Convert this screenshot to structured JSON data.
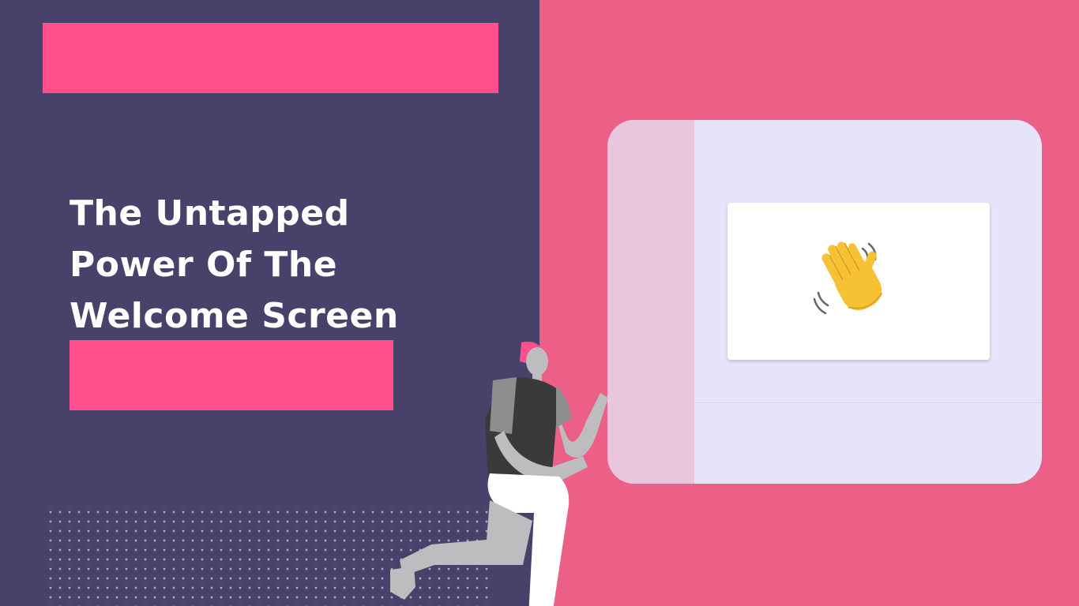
{
  "headline": {
    "lines": [
      "The Untapped",
      "Power Of The",
      "Welcome Screen"
    ]
  },
  "colors": {
    "left_background": "#48416a",
    "right_background": "#ec5f86",
    "accent_bar": "#ff4f8c",
    "mock_window": "#e5e4fa",
    "mock_sidebar": "#e8c6de"
  },
  "icons": {
    "welcome_card": "waving-hand-icon",
    "illustration": "kneeling-person-illustration"
  }
}
